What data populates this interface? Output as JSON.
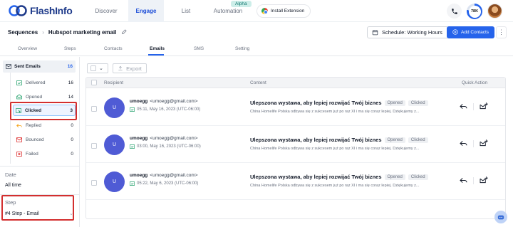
{
  "app": {
    "brand": "FlashInfo",
    "alpha_badge": "Alpha",
    "credits": "78K",
    "credits_fraction": 0.78
  },
  "nav": {
    "items": [
      {
        "label": "Discover"
      },
      {
        "label": "Engage"
      },
      {
        "label": "List"
      },
      {
        "label": "Automation"
      }
    ],
    "extension_label": "Install Extension"
  },
  "header": {
    "breadcrumb_root": "Sequences",
    "sequence_name": "Hubspot marketing email",
    "schedule_label": "Schedule: Working Hours",
    "add_contacts_label": "Add Contacts"
  },
  "subtabs": [
    "Overview",
    "Steps",
    "Contacts",
    "Emails",
    "SMS",
    "Setting"
  ],
  "sidebar": {
    "head": {
      "label": "Sent Emails",
      "count": "16"
    },
    "items": [
      {
        "label": "Delivered",
        "count": "16"
      },
      {
        "label": "Opened",
        "count": "14"
      },
      {
        "label": "Clicked",
        "count": "3"
      },
      {
        "label": "Replied",
        "count": "0"
      },
      {
        "label": "Bounced",
        "count": "0"
      },
      {
        "label": "Failed",
        "count": "0"
      }
    ],
    "date_label": "Date",
    "date_value": "All time",
    "step_label": "Step",
    "step_value": "#4 Step - Email"
  },
  "toolbar": {
    "export_label": "Export"
  },
  "table": {
    "headers": {
      "recipient": "Recipient",
      "content": "Content",
      "action": "Quick Action"
    },
    "rows": [
      {
        "initial": "U",
        "name": "umoegg",
        "email": "<umoegg@gmail.com>",
        "time": "05:11, May 16, 2023 (UTC-06:00)",
        "subject": "Ulepszona wystawa, aby lepiej rozwijać Twój biznes",
        "tag1": "Opened",
        "tag2": "Clicked",
        "preview": "China Homelife Polska odbywa się z sukcesem już po raz XI i ma się coraz lepiej. Dziękujemy z..."
      },
      {
        "initial": "U",
        "name": "umoegg",
        "email": "<umoegg@gmail.com>",
        "time": "03:00, May 16, 2023 (UTC-06:00)",
        "subject": "Ulepszona wystawa, aby lepiej rozwijać Twój biznes",
        "tag1": "Opened",
        "tag2": "Clicked",
        "preview": "China Homelife Polska odbywa się z sukcesem już po raz XI i ma się coraz lepiej. Dziękujemy z..."
      },
      {
        "initial": "U",
        "name": "umoegg",
        "email": "<umoegg@gmail.com>",
        "time": "05:22, May 6, 2023 (UTC-06:00)",
        "subject": "Ulepszona wystawa, aby lepiej rozwijać Twój biznes",
        "tag1": "Opened",
        "tag2": "Clicked",
        "preview": "China Homelife Polska odbywa się z sukcesem już po raz XI i ma się coraz lepiej. Dziękujemy z..."
      }
    ]
  },
  "colors": {
    "accent": "#2563eb",
    "highlight": "#d32f2f",
    "avatar": "#4f5bd5"
  }
}
